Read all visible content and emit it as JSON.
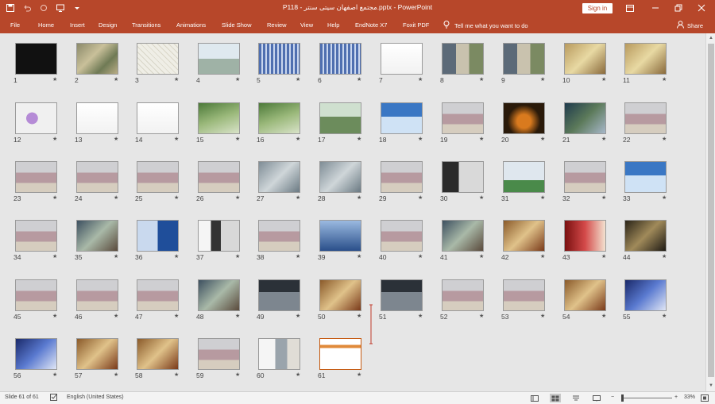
{
  "titlebar": {
    "title": "P118 - مجتمع اصفهان سیتی سنتر.pptx - PowerPoint",
    "sign_in": "Sign in"
  },
  "ribbon": {
    "tabs": [
      "File",
      "Home",
      "Insert",
      "Design",
      "Transitions",
      "Animations",
      "Slide Show",
      "Review",
      "View",
      "Help",
      "EndNote X7",
      "Foxit PDF"
    ],
    "tell_me": "Tell me what you want to do",
    "share": "Share"
  },
  "slides": [
    {
      "num": "1",
      "theme": "dark-title"
    },
    {
      "num": "2",
      "theme": "site-photo"
    },
    {
      "num": "3",
      "theme": "map"
    },
    {
      "num": "4",
      "theme": "render-light"
    },
    {
      "num": "5",
      "theme": "facade-blue"
    },
    {
      "num": "6",
      "theme": "facade-blue"
    },
    {
      "num": "7",
      "theme": "plan-white"
    },
    {
      "num": "8",
      "theme": "photo-collage"
    },
    {
      "num": "9",
      "theme": "photo-collage"
    },
    {
      "num": "10",
      "theme": "photo-warm"
    },
    {
      "num": "11",
      "theme": "photo-warm"
    },
    {
      "num": "12",
      "theme": "colored-plan"
    },
    {
      "num": "13",
      "theme": "plan-white"
    },
    {
      "num": "14",
      "theme": "plan-white"
    },
    {
      "num": "15",
      "theme": "aerial-green"
    },
    {
      "num": "16",
      "theme": "aerial-green"
    },
    {
      "num": "17",
      "theme": "render-green"
    },
    {
      "num": "18",
      "theme": "render-blue"
    },
    {
      "num": "19",
      "theme": "facade-pink"
    },
    {
      "num": "20",
      "theme": "night"
    },
    {
      "num": "21",
      "theme": "aerial-dark"
    },
    {
      "num": "22",
      "theme": "facade-pink"
    },
    {
      "num": "23",
      "theme": "facade-pink"
    },
    {
      "num": "24",
      "theme": "facade-pink"
    },
    {
      "num": "25",
      "theme": "facade-pink"
    },
    {
      "num": "26",
      "theme": "facade-pink"
    },
    {
      "num": "27",
      "theme": "interior"
    },
    {
      "num": "28",
      "theme": "interior"
    },
    {
      "num": "29",
      "theme": "facade-pink"
    },
    {
      "num": "30",
      "theme": "sketch-dark"
    },
    {
      "num": "31",
      "theme": "towers-sky"
    },
    {
      "num": "32",
      "theme": "facade-pink"
    },
    {
      "num": "33",
      "theme": "render-blue"
    },
    {
      "num": "34",
      "theme": "facade-pink"
    },
    {
      "num": "35",
      "theme": "mall-interior"
    },
    {
      "num": "36",
      "theme": "tower-blue"
    },
    {
      "num": "37",
      "theme": "tower-sketch"
    },
    {
      "num": "38",
      "theme": "facade-pink"
    },
    {
      "num": "39",
      "theme": "towers-blue"
    },
    {
      "num": "40",
      "theme": "facade-pink"
    },
    {
      "num": "41",
      "theme": "mall-interior"
    },
    {
      "num": "42",
      "theme": "mall-warm"
    },
    {
      "num": "43",
      "theme": "mall-red"
    },
    {
      "num": "44",
      "theme": "mall-dark"
    },
    {
      "num": "45",
      "theme": "facade-pink"
    },
    {
      "num": "46",
      "theme": "facade-pink"
    },
    {
      "num": "47",
      "theme": "facade-pink"
    },
    {
      "num": "48",
      "theme": "mall-interior"
    },
    {
      "num": "49",
      "theme": "parking"
    },
    {
      "num": "50",
      "theme": "mall-warm"
    },
    {
      "num": "51",
      "theme": "parking"
    },
    {
      "num": "52",
      "theme": "facade-pink"
    },
    {
      "num": "53",
      "theme": "facade-pink"
    },
    {
      "num": "54",
      "theme": "mall-warm"
    },
    {
      "num": "55",
      "theme": "mall-blue"
    },
    {
      "num": "56",
      "theme": "mall-blue"
    },
    {
      "num": "57",
      "theme": "mall-warm"
    },
    {
      "num": "58",
      "theme": "mall-warm"
    },
    {
      "num": "59",
      "theme": "facade-pink"
    },
    {
      "num": "60",
      "theme": "collage-white"
    },
    {
      "num": "61",
      "theme": "diagram-orange"
    }
  ],
  "statusbar": {
    "slide_info": "Slide 61 of 61",
    "language": "English (United States)",
    "zoom": "33%"
  },
  "colors": {
    "ribbon": "#b7472a",
    "background": "#e6e6e6"
  }
}
